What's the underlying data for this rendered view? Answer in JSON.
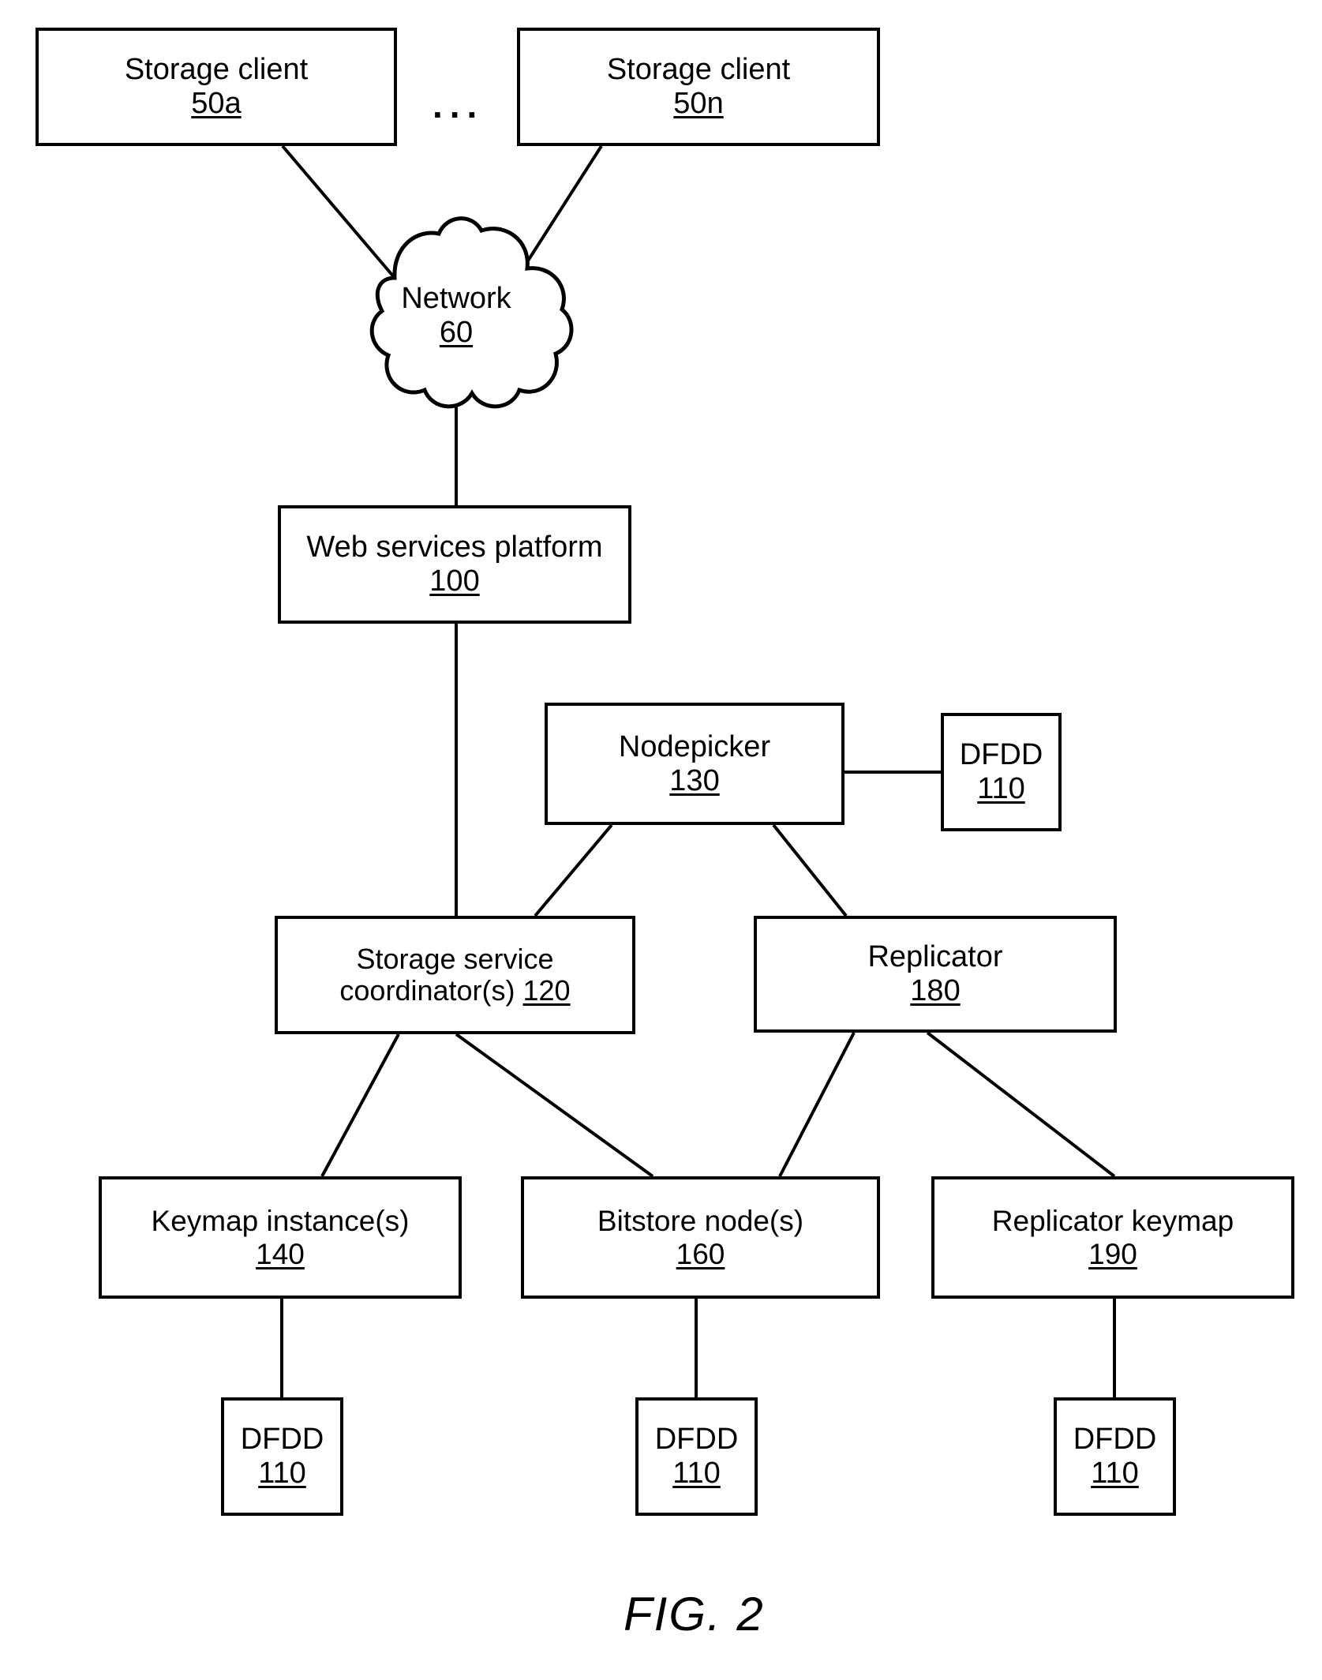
{
  "figure": {
    "caption": "FIG. 2",
    "ellipsis": "...",
    "stroke_color": "#000000",
    "background_color": "#ffffff"
  },
  "nodes": {
    "storage_client_a": {
      "label": "Storage client",
      "ref": "50a"
    },
    "storage_client_n": {
      "label": "Storage client",
      "ref": "50n"
    },
    "network": {
      "label": "Network",
      "ref": "60"
    },
    "web_platform": {
      "label": "Web services platform",
      "ref": "100"
    },
    "nodepicker": {
      "label": "Nodepicker",
      "ref": "130"
    },
    "dfdd_nodepicker": {
      "label": "DFDD",
      "ref": "110"
    },
    "coordinator": {
      "label_line1": "Storage service",
      "label_line2": "coordinator(s)",
      "ref": "120"
    },
    "replicator": {
      "label": "Replicator",
      "ref": "180"
    },
    "keymap_instance": {
      "label": "Keymap instance(s)",
      "ref": "140"
    },
    "bitstore": {
      "label": "Bitstore node(s)",
      "ref": "160"
    },
    "replicator_keymap": {
      "label": "Replicator keymap",
      "ref": "190"
    },
    "dfdd_keymap": {
      "label": "DFDD",
      "ref": "110"
    },
    "dfdd_bitstore": {
      "label": "DFDD",
      "ref": "110"
    },
    "dfdd_replicator_keymap": {
      "label": "DFDD",
      "ref": "110"
    }
  },
  "edges": [
    {
      "from": "storage_client_a",
      "to": "network"
    },
    {
      "from": "storage_client_n",
      "to": "network"
    },
    {
      "from": "network",
      "to": "web_platform"
    },
    {
      "from": "web_platform",
      "to": "coordinator"
    },
    {
      "from": "nodepicker",
      "to": "dfdd_nodepicker"
    },
    {
      "from": "nodepicker",
      "to": "coordinator"
    },
    {
      "from": "nodepicker",
      "to": "replicator"
    },
    {
      "from": "coordinator",
      "to": "keymap_instance"
    },
    {
      "from": "coordinator",
      "to": "bitstore"
    },
    {
      "from": "replicator",
      "to": "bitstore"
    },
    {
      "from": "replicator",
      "to": "replicator_keymap"
    },
    {
      "from": "keymap_instance",
      "to": "dfdd_keymap"
    },
    {
      "from": "bitstore",
      "to": "dfdd_bitstore"
    },
    {
      "from": "replicator_keymap",
      "to": "dfdd_replicator_keymap"
    }
  ]
}
